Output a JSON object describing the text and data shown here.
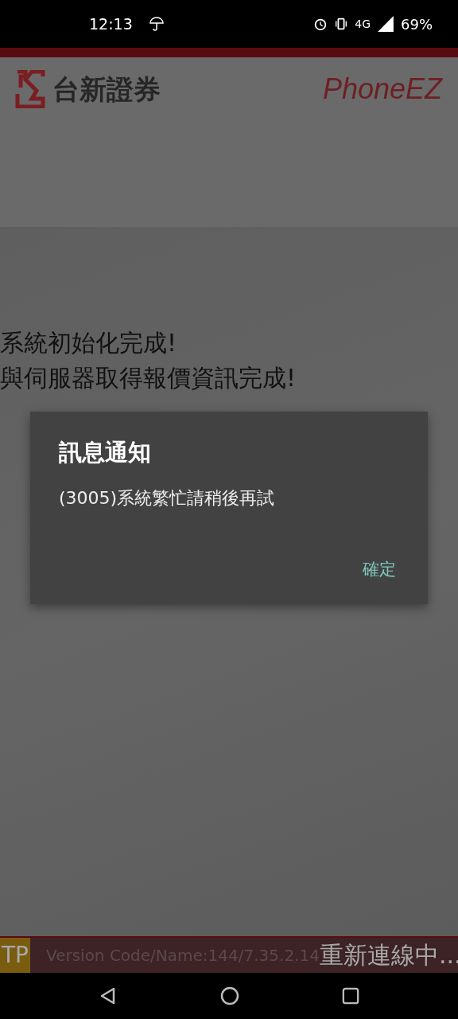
{
  "status_bar": {
    "time": "12:13",
    "battery": "69%",
    "network": "4G"
  },
  "header": {
    "brand": "台新證券",
    "app_name": "PhoneEZ"
  },
  "messages": [
    "系統初始化完成!",
    "與伺服器取得報價資訊完成!"
  ],
  "dialog": {
    "title": "訊息通知",
    "message": "(3005)系統繁忙請稍後再試",
    "button": "確定"
  },
  "footer": {
    "badge": "TP",
    "version": "Version Code/Name:144/7.35.2.14",
    "status": "重新連線中..."
  }
}
